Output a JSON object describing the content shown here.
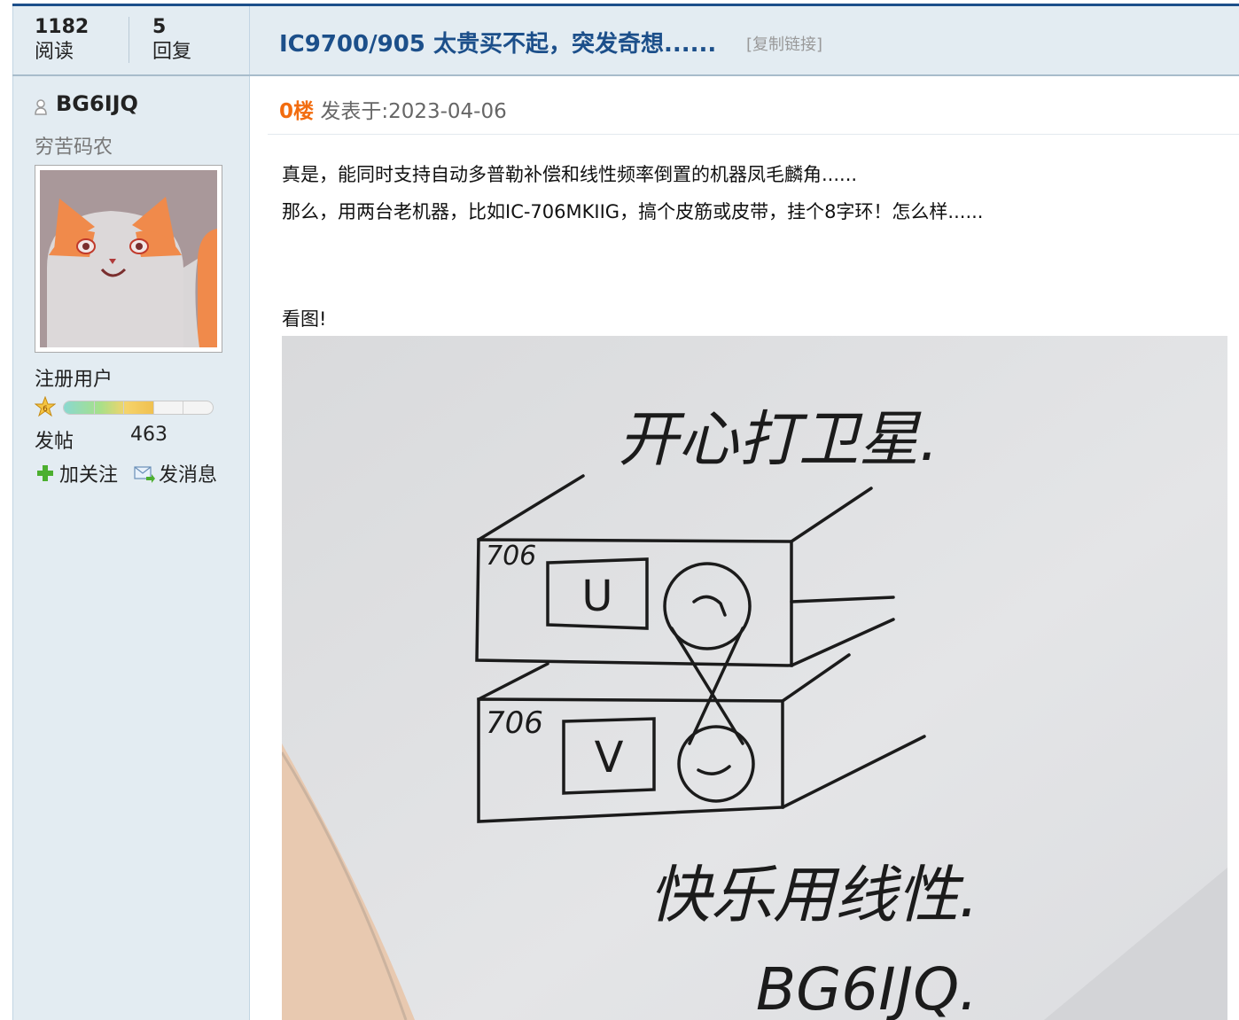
{
  "thread": {
    "views_count": "1182",
    "views_label": "阅读",
    "replies_count": "5",
    "replies_label": "回复",
    "title": "IC9700/905 太贵买不起，突发奇想......",
    "copy_link": "[复制链接]"
  },
  "author": {
    "username": "BG6IJQ",
    "user_title": "穷苦码农",
    "group": "注册用户",
    "level_progress_fraction": 0.6,
    "posts_label": "发帖",
    "posts_count": "463",
    "follow_label": "加关注",
    "message_label": "发消息"
  },
  "post": {
    "floor": "0楼",
    "posted_label": "发表于:",
    "date": "2023-04-06",
    "lines": [
      "真是，能同时支持自动多普勒补偿和线性频率倒置的机器凤毛麟角......",
      "那么，用两台老机器，比如IC-706MKIIG，搞个皮筋或皮带，挂个8字环！怎么样......"
    ],
    "look_label": "看图!"
  },
  "image": {
    "caption_top": "开心打卫星.",
    "radio_top_model": "706",
    "radio_top_label": "U",
    "radio_bottom_model": "706",
    "radio_bottom_label": "V",
    "caption_bottom": "快乐用线性.",
    "signature": "BG6IJQ."
  },
  "colors": {
    "title_blue": "#1c4f8a",
    "floor_orange": "#f26c0f",
    "sidebar_bg": "#e3ecf2"
  }
}
